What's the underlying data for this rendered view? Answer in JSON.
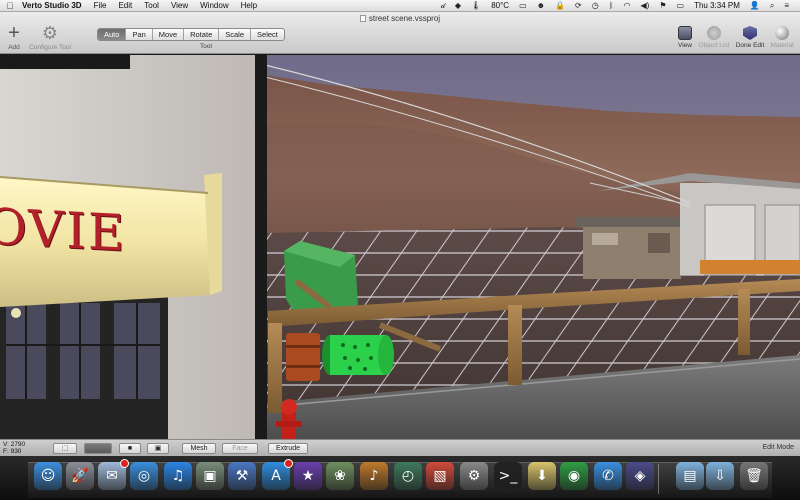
{
  "menubar": {
    "app_name": "Verto Studio 3D",
    "menus": [
      "File",
      "Edit",
      "Tool",
      "View",
      "Window",
      "Help"
    ],
    "status": {
      "temperature": "80°C",
      "clock": "Thu 3:34 PM"
    }
  },
  "toolbar": {
    "document_title": "street scene.vssproj",
    "add_label": "Add",
    "configure_label": "Configure Tool",
    "tool_caption": "Tool",
    "tools": [
      {
        "label": "Auto",
        "active": true
      },
      {
        "label": "Pan",
        "active": false
      },
      {
        "label": "Move",
        "active": false
      },
      {
        "label": "Rotate",
        "active": false
      },
      {
        "label": "Scale",
        "active": false
      },
      {
        "label": "Select",
        "active": false
      }
    ],
    "right_buttons": {
      "view": "View",
      "object_list": "Object List",
      "done_edit": "Done Edit",
      "material": "Material"
    }
  },
  "viewport": {
    "sign_text": "OVIE"
  },
  "editbar": {
    "vertex_count": "V: 2790",
    "face_count": "F: 930",
    "mesh_label": "Mesh",
    "face_label": "Face",
    "extrude_label": "Extrude",
    "mode_label": "Edit Mode"
  },
  "dock": {
    "icons": [
      {
        "name": "finder-icon",
        "glyph": "☺",
        "color": "#3d8fe0"
      },
      {
        "name": "launchpad-icon",
        "glyph": "🚀",
        "color": "#8b8f99"
      },
      {
        "name": "mail-icon",
        "glyph": "✉",
        "color": "#9fb9d8",
        "badge": true
      },
      {
        "name": "safari-icon",
        "glyph": "◎",
        "color": "#3a8fdd"
      },
      {
        "name": "itunes-icon",
        "glyph": "♫",
        "color": "#2c86e6"
      },
      {
        "name": "preview-icon",
        "glyph": "▣",
        "color": "#7a8d7a"
      },
      {
        "name": "xcode-icon",
        "glyph": "⚒",
        "color": "#4a78c4"
      },
      {
        "name": "app-store-icon",
        "glyph": "A",
        "color": "#2f8ee0",
        "badge": true
      },
      {
        "name": "imovie-icon",
        "glyph": "★",
        "color": "#6c3fb0"
      },
      {
        "name": "iphoto-icon",
        "glyph": "❀",
        "color": "#6f8f5f"
      },
      {
        "name": "garageband-icon",
        "glyph": "♪",
        "color": "#c07a2c"
      },
      {
        "name": "time-machine-icon",
        "glyph": "◴",
        "color": "#3f7a5c"
      },
      {
        "name": "parallels-icon",
        "glyph": "▧",
        "color": "#d24b3a"
      },
      {
        "name": "system-preferences-icon",
        "glyph": "⚙",
        "color": "#8a8a8a"
      },
      {
        "name": "terminal-icon",
        "glyph": ">_",
        "color": "#222"
      },
      {
        "name": "installer-icon",
        "glyph": "⬇",
        "color": "#d8c46a"
      },
      {
        "name": "chrome-icon",
        "glyph": "◉",
        "color": "#2f9e45"
      },
      {
        "name": "messages-icon",
        "glyph": "✆",
        "color": "#3a8fe0"
      },
      {
        "name": "vertostudio-icon",
        "glyph": "◈",
        "color": "#4b4d8a"
      },
      {
        "name": "applications-folder-icon",
        "glyph": "▤",
        "color": "#7fb2dc"
      },
      {
        "name": "downloads-folder-icon",
        "glyph": "⇩",
        "color": "#7fb2dc"
      },
      {
        "name": "trash-icon",
        "glyph": "🗑",
        "color": "#777"
      }
    ]
  }
}
